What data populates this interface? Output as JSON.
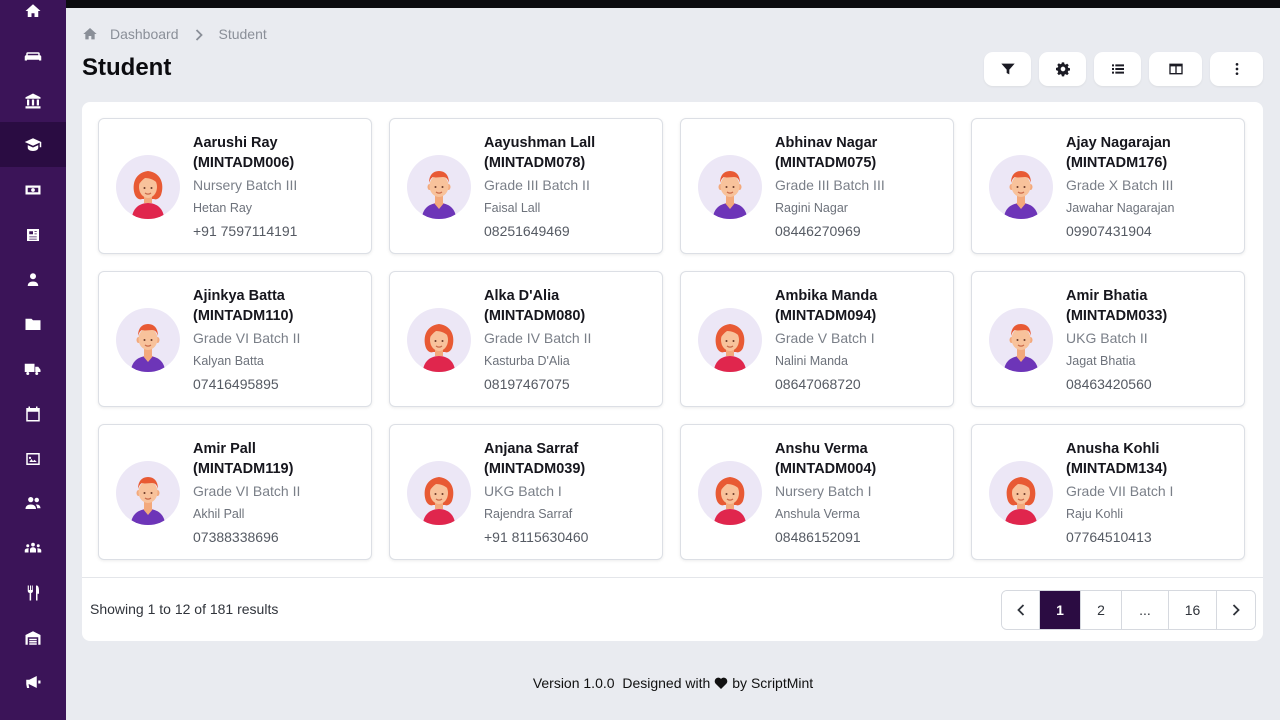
{
  "sidebar": {
    "items": [
      {
        "icon": "home-icon"
      },
      {
        "icon": "sofa-icon"
      },
      {
        "icon": "bank-icon"
      },
      {
        "icon": "graduate-icon",
        "active": true
      },
      {
        "icon": "money-icon"
      },
      {
        "icon": "newspaper-icon"
      },
      {
        "icon": "user-icon"
      },
      {
        "icon": "folder-icon"
      },
      {
        "icon": "truck-icon"
      },
      {
        "icon": "calendar-icon"
      },
      {
        "icon": "image-icon"
      },
      {
        "icon": "users-icon"
      },
      {
        "icon": "group-icon"
      },
      {
        "icon": "utensils-icon"
      },
      {
        "icon": "warehouse-icon"
      },
      {
        "icon": "megaphone-icon"
      }
    ]
  },
  "breadcrumb": {
    "home": "Dashboard",
    "current": "Student"
  },
  "page": {
    "title": "Student"
  },
  "toolbar": {
    "buttons": [
      {
        "icon": "filter-icon"
      },
      {
        "icon": "gear-icon"
      },
      {
        "icon": "list-icon"
      },
      {
        "icon": "columns-icon"
      },
      {
        "icon": "more-vertical-icon"
      }
    ]
  },
  "students": [
    {
      "name": "Aarushi Ray",
      "code": "(MINTADM006)",
      "batch": "Nursery Batch III",
      "guardian": "Hetan Ray",
      "phone": "+91 7597114191",
      "gender": "female"
    },
    {
      "name": "Aayushman Lall",
      "code": "(MINTADM078)",
      "batch": "Grade III Batch II",
      "guardian": "Faisal Lall",
      "phone": "08251649469",
      "gender": "male"
    },
    {
      "name": "Abhinav Nagar",
      "code": "(MINTADM075)",
      "batch": "Grade III Batch III",
      "guardian": "Ragini Nagar",
      "phone": "08446270969",
      "gender": "male"
    },
    {
      "name": "Ajay Nagarajan",
      "code": "(MINTADM176)",
      "batch": "Grade X Batch III",
      "guardian": "Jawahar Nagarajan",
      "phone": "09907431904",
      "gender": "male"
    },
    {
      "name": "Ajinkya Batta",
      "code": "(MINTADM110)",
      "batch": "Grade VI Batch II",
      "guardian": "Kalyan Batta",
      "phone": "07416495895",
      "gender": "male"
    },
    {
      "name": "Alka D'Alia",
      "code": "(MINTADM080)",
      "batch": "Grade IV Batch II",
      "guardian": "Kasturba D'Alia",
      "phone": "08197467075",
      "gender": "female"
    },
    {
      "name": "Ambika Manda",
      "code": "(MINTADM094)",
      "batch": "Grade V Batch I",
      "guardian": "Nalini Manda",
      "phone": "08647068720",
      "gender": "female"
    },
    {
      "name": "Amir Bhatia",
      "code": "(MINTADM033)",
      "batch": "UKG Batch II",
      "guardian": "Jagat Bhatia",
      "phone": "08463420560",
      "gender": "male"
    },
    {
      "name": "Amir Pall",
      "code": "(MINTADM119)",
      "batch": "Grade VI Batch II",
      "guardian": "Akhil Pall",
      "phone": "07388338696",
      "gender": "male"
    },
    {
      "name": "Anjana Sarraf",
      "code": "(MINTADM039)",
      "batch": "UKG Batch I",
      "guardian": "Rajendra Sarraf",
      "phone": "+91 8115630460",
      "gender": "female"
    },
    {
      "name": "Anshu Verma",
      "code": "(MINTADM004)",
      "batch": "Nursery Batch I",
      "guardian": "Anshula Verma",
      "phone": "08486152091",
      "gender": "female"
    },
    {
      "name": "Anusha Kohli",
      "code": "(MINTADM134)",
      "batch": "Grade VII Batch I",
      "guardian": "Raju Kohli",
      "phone": "07764510413",
      "gender": "female"
    }
  ],
  "pagination": {
    "summary": "Showing 1 to 12 of 181 results",
    "pages": [
      "1",
      "2",
      "...",
      "16"
    ],
    "current": "1"
  },
  "footer": {
    "version": "Version 1.0.0",
    "designed": "Designed with",
    "by": "by ScriptMint"
  },
  "colors": {
    "sidebar": "#3b1458",
    "sidebar_active": "#2a0c42",
    "page_active": "#2b0c42",
    "background": "#e9ebf0"
  }
}
